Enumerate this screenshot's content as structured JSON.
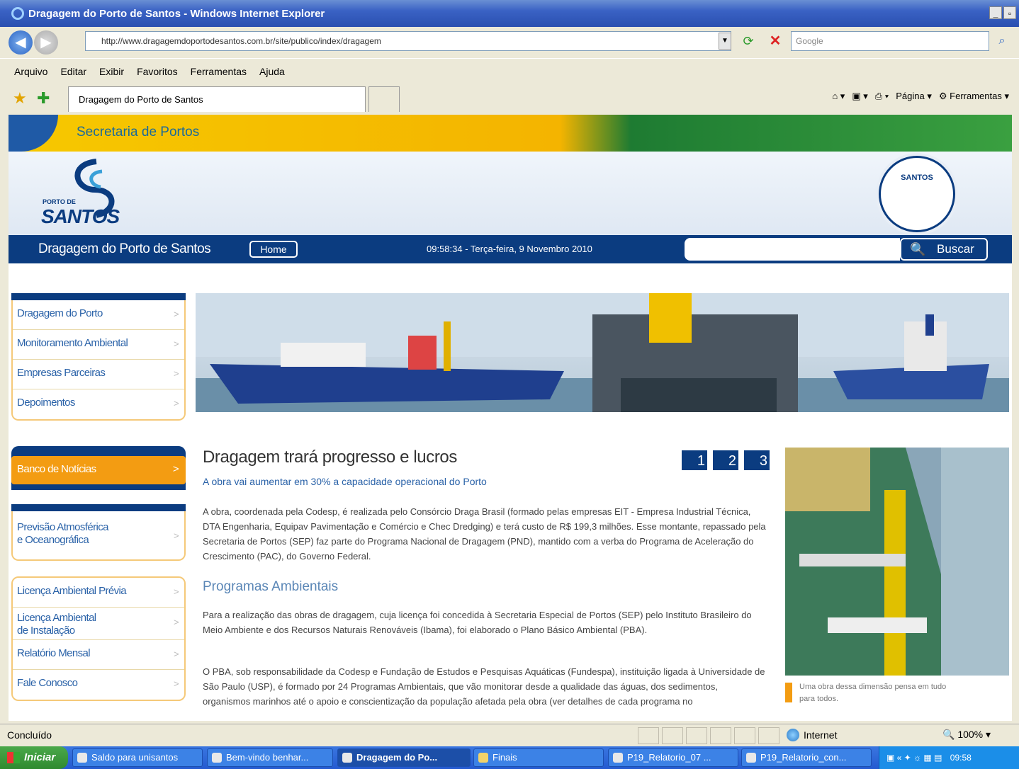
{
  "window": {
    "title": "Dragagem do Porto de Santos - Windows Internet Explorer"
  },
  "addressbar": {
    "url": "http://www.dragagemdoportodesantos.com.br/site/publico/index/dragagem",
    "search_placeholder": "Google"
  },
  "menubar": {
    "items": [
      "Arquivo",
      "Editar",
      "Exibir",
      "Favoritos",
      "Ferramentas",
      "Ajuda"
    ]
  },
  "tabbar": {
    "tab_title": "Dragagem do Porto de Santos",
    "page_label": "Página",
    "tools_label": "Ferramentas"
  },
  "site": {
    "secretaria": "Secretaria de Portos",
    "logo_text": "SANTOS",
    "logo_small": "PORTO DE",
    "seal_text": "SANTOS",
    "title": "Dragagem do Porto de Santos",
    "home_label": "Home",
    "datetime": "09:58:34 - Terça-feira, 9 Novembro 2010",
    "search_button": "Buscar"
  },
  "leftnav": {
    "group1": [
      "Dragagem do Porto",
      "Monitoramento Ambiental",
      "Empresas Parceiras",
      "Depoimentos"
    ],
    "noticias": "Banco de Notícias",
    "group2": [
      "Previsão Atmosférica\ne Oceanográfica"
    ],
    "group3": [
      "Licença Ambiental Prévia",
      "Licença Ambiental\nde Instalação",
      "Relatório Mensal",
      "Fale Conosco"
    ]
  },
  "article": {
    "headline": "Dragagem trará progresso e lucros",
    "subhead": "A obra vai aumentar em 30% a capacidade operacional do Porto",
    "pager": [
      "1",
      "2",
      "3"
    ],
    "para1": "A obra, coordenada pela Codesp, é realizada pelo Consórcio Draga Brasil (formado pelas empresas EIT - Empresa Industrial Técnica, DTA Engenharia, Equipav Pavimentação e Comércio e Chec Dredging) e terá custo de R$ 199,3 milhões. Esse montante, repassado pela Secretaria de Portos (SEP) faz parte do Programa Nacional de Dragagem (PND), mantido com a verba do Programa de Aceleração do Crescimento (PAC), do Governo Federal.",
    "section_title": "Programas Ambientais",
    "para2": "Para a realização das obras de dragagem, cuja licença foi concedida à Secretaria Especial de Portos (SEP) pelo Instituto Brasileiro do Meio Ambiente e dos Recursos Naturais Renováveis (Ibama), foi elaborado o Plano Básico Ambiental (PBA).",
    "para3": "O PBA, sob responsabilidade da Codesp e Fundação de Estudos e Pesquisas Aquáticas (Fundespa), instituição ligada à Universidade de São Paulo (USP), é formado por 24 Programas Ambientais, que vão monitorar desde a qualidade das águas, dos sedimentos, organismos marinhos até o apoio e conscientização da população afetada pela obra (ver detalhes de cada programa no",
    "caption": "Uma obra dessa dimensão pensa em tudo para todos."
  },
  "statusbar": {
    "status": "Concluído",
    "zone": "Internet",
    "zoom": "100%"
  },
  "taskbar": {
    "start": "Iniciar",
    "tasks": [
      "Saldo para unisantos",
      "Bem-vindo benhar...",
      "Dragagem do Po...",
      "Finais",
      "P19_Relatorio_07 ...",
      "P19_Relatorio_con..."
    ],
    "clock": "09:58"
  },
  "colors": {
    "navy": "#0b3c80",
    "orange": "#f39c12",
    "link_blue": "#2a62a8"
  }
}
